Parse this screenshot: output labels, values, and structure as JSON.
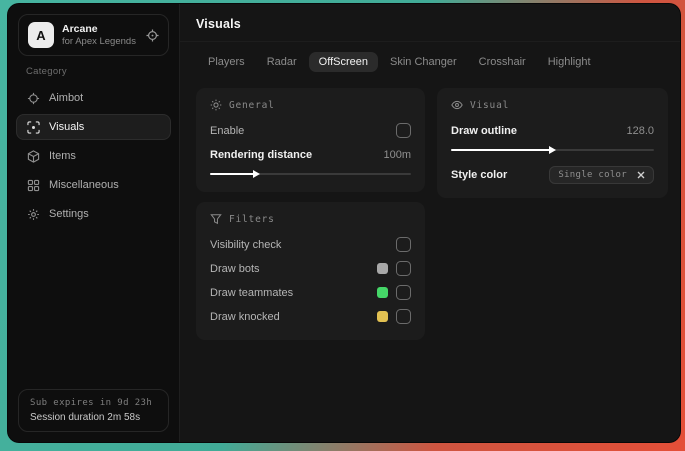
{
  "app": {
    "logo_letter": "A",
    "name": "Arcane",
    "subtitle": "for Apex Legends"
  },
  "sidebar": {
    "category_label": "Category",
    "items": [
      {
        "label": "Aimbot",
        "icon": "crosshair-icon",
        "selected": false
      },
      {
        "label": "Visuals",
        "icon": "focus-icon",
        "selected": true
      },
      {
        "label": "Items",
        "icon": "cube-icon",
        "selected": false
      },
      {
        "label": "Miscellaneous",
        "icon": "grid-icon",
        "selected": false
      },
      {
        "label": "Settings",
        "icon": "gear-icon",
        "selected": false
      }
    ],
    "footer": {
      "sub_expires": "Sub expires in 9d 23h",
      "session_duration": "Session duration 2m 58s"
    }
  },
  "main": {
    "title": "Visuals",
    "tabs": [
      {
        "label": "Players",
        "selected": false
      },
      {
        "label": "Radar",
        "selected": false
      },
      {
        "label": "OffScreen",
        "selected": true
      },
      {
        "label": "Skin Changer",
        "selected": false
      },
      {
        "label": "Crosshair",
        "selected": false
      },
      {
        "label": "Highlight",
        "selected": false
      }
    ],
    "panels": {
      "general": {
        "title": "General",
        "enable": {
          "label": "Enable",
          "checked": false
        },
        "rendering_distance": {
          "label": "Rendering distance",
          "value": "100m",
          "fill": "22%"
        }
      },
      "visual": {
        "title": "Visual",
        "draw_outline": {
          "label": "Draw outline",
          "value": "128.0",
          "fill": "49%"
        },
        "style_color": {
          "label": "Style color",
          "value": "Single color"
        }
      },
      "filters": {
        "title": "Filters",
        "rows": [
          {
            "label": "Visibility check",
            "swatch": null,
            "checked": false
          },
          {
            "label": "Draw bots",
            "swatch": "#a8a8a8",
            "checked": false
          },
          {
            "label": "Draw teammates",
            "swatch": "#45d768",
            "checked": false
          },
          {
            "label": "Draw knocked",
            "swatch": "#e2c152",
            "checked": false
          }
        ]
      }
    }
  },
  "colors": {
    "wallpaper_teal": "#44b4a0",
    "wallpaper_red": "#e2503a",
    "swatch_gray": "#a8a8a8",
    "swatch_green": "#45d768",
    "swatch_yellow": "#e2c152"
  }
}
